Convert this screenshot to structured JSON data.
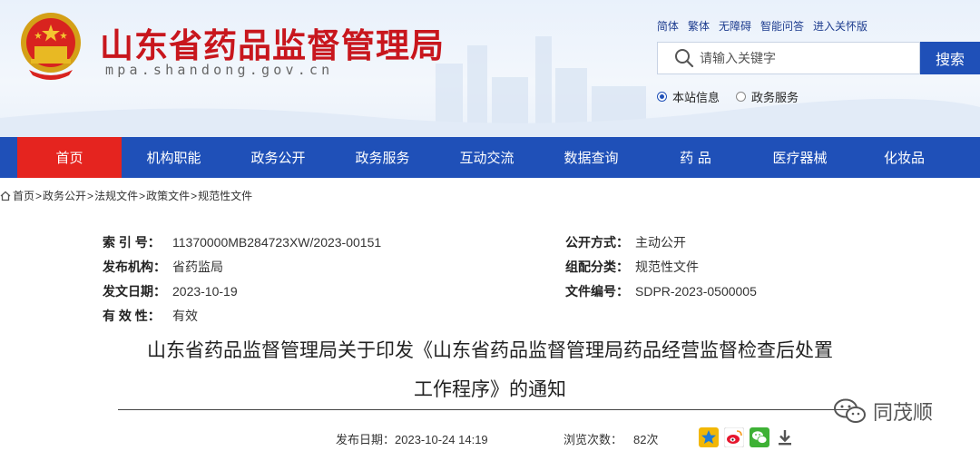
{
  "header": {
    "site_title": "山东省药品监督管理局",
    "site_domain": "mpa.shandong.gov.cn",
    "top_links": [
      "简体",
      "繁体",
      "无障碍",
      "智能问答",
      "进入关怀版"
    ],
    "search": {
      "placeholder": "请输入关键字",
      "button_label": "搜索"
    },
    "radio_options": [
      {
        "label": "本站信息",
        "checked": true
      },
      {
        "label": "政务服务",
        "checked": false
      }
    ]
  },
  "nav": {
    "items": [
      "首页",
      "机构职能",
      "政务公开",
      "政务服务",
      "互动交流",
      "数据查询",
      "药 品",
      "医疗器械",
      "化妆品"
    ],
    "active_index": 0
  },
  "breadcrumb": [
    "首页",
    "政务公开",
    "法规文件",
    "政策文件",
    "规范性文件"
  ],
  "meta": {
    "index_label": "索 引 号：",
    "index_value": "11370000MB284723XW/2023-00151",
    "publish_mode_label": "公开方式：",
    "publish_mode_value": "主动公开",
    "issuer_label": "发布机构：",
    "issuer_value": "省药监局",
    "category_label": "组配分类：",
    "category_value": "规范性文件",
    "issue_date_label": "发文日期：",
    "issue_date_value": "2023-10-19",
    "doc_number_label": "文件编号：",
    "doc_number_value": "SDPR-2023-0500005",
    "validity_label": "有 效 性：",
    "validity_value": "有效"
  },
  "document": {
    "title_line1": "山东省药品监督管理局关于印发《山东省药品监督管理局药品经营监督检查后处置",
    "title_line2": "工作程序》的通知",
    "publish_date_label": "发布日期：",
    "publish_date_value": "2023-10-24 14:19",
    "views_label": "浏览次数：",
    "views_value": "82次"
  },
  "watermark": {
    "text": "同茂顺"
  },
  "colors": {
    "brand_red": "#c8161d",
    "nav_blue": "#1f50b8",
    "nav_active": "#e5241f"
  }
}
